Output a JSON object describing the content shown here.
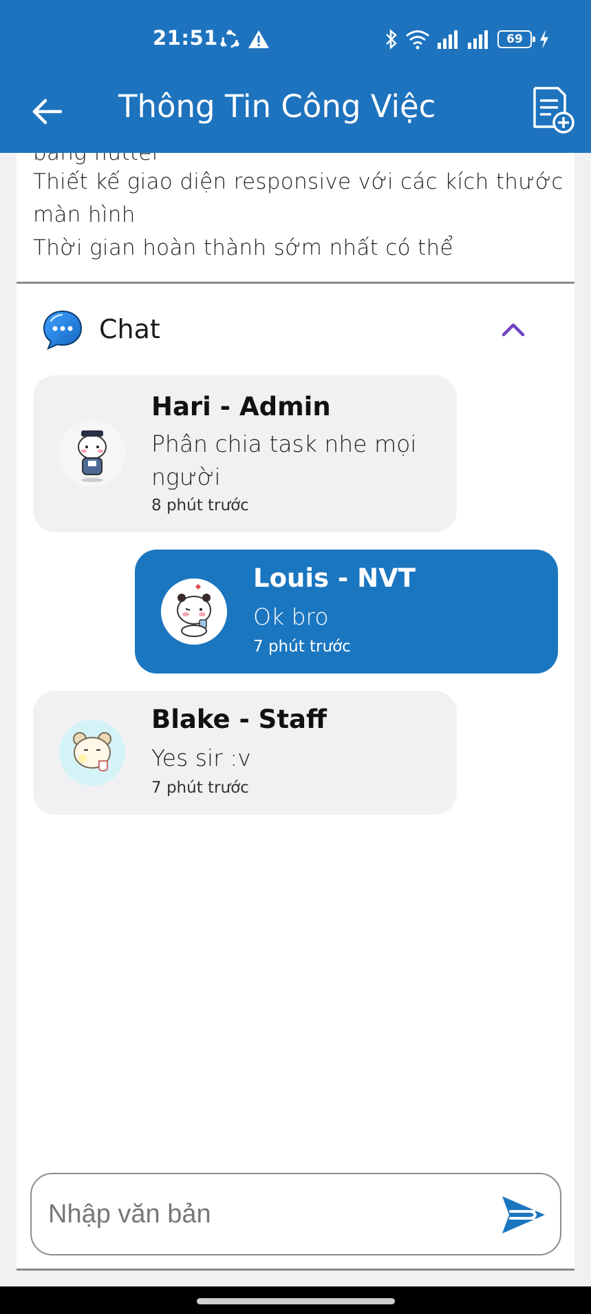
{
  "status_bar": {
    "time": "21:51",
    "battery": "69",
    "icons": [
      "sync-icon",
      "warning-icon",
      "bluetooth-icon",
      "wifi-icon",
      "signal-icon",
      "signal-icon",
      "battery-icon",
      "charging-icon"
    ]
  },
  "toolbar": {
    "title": "Thông Tin Công Việc",
    "back_icon": "arrow-left-icon",
    "action_icon": "add-document-icon"
  },
  "description": {
    "lines": [
      "bằng flutter",
      "Thiết kế giao diện responsive với các kích thước",
      "màn hình",
      "Thời gian hoàn thành sớm nhất có thể"
    ]
  },
  "chat": {
    "title": "Chat",
    "icon": "chat-bubble-icon",
    "collapse_icon": "chevron-up-icon",
    "messages": [
      {
        "sender": "Hari - Admin",
        "text": "Phân chia task nhe mọi người",
        "time": "8 phút trước",
        "mine": false
      },
      {
        "sender": "Louis - NVT",
        "text": "Ok bro",
        "time": "7 phút trước",
        "mine": true
      },
      {
        "sender": "Blake - Staff",
        "text": "Yes sir :v",
        "time": "7 phút trước",
        "mine": false
      }
    ]
  },
  "composer": {
    "placeholder": "Nhập văn bản",
    "value": "",
    "send_icon": "send-icon"
  },
  "colors": {
    "primary": "#1e73be",
    "my_bubble": "#1b76c0",
    "other_bubble": "#f1f1f3",
    "chevron": "#6f42c1"
  }
}
